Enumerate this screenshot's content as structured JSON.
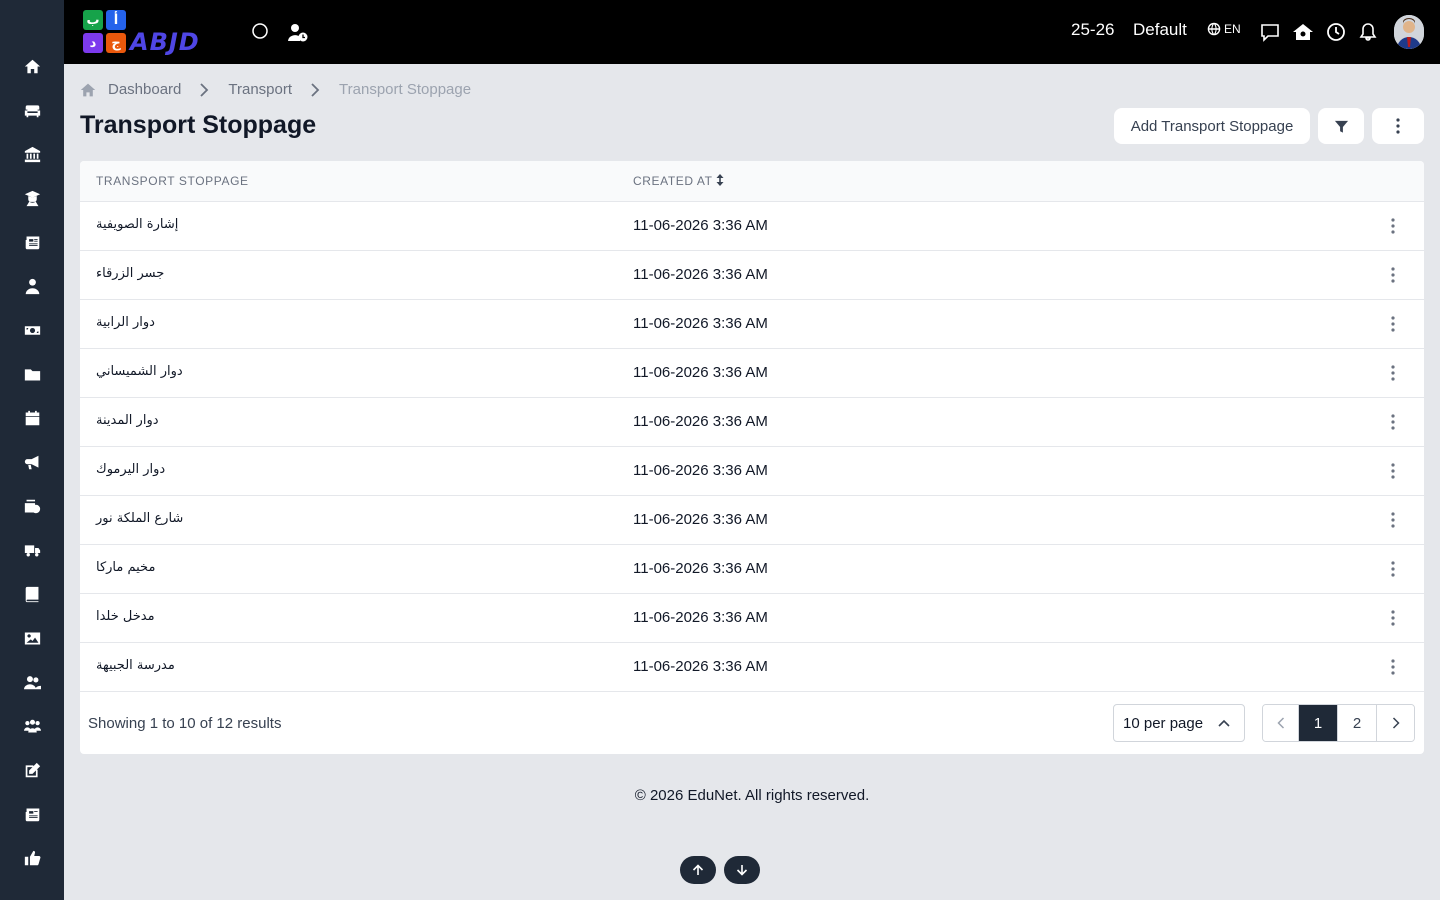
{
  "app": {
    "logo_letters": [
      "ب",
      "أ",
      "ج",
      "د"
    ],
    "logo_word": "ABJD",
    "brand_color": "#4f46e5"
  },
  "topbar": {
    "session": "25-26",
    "profile": "Default",
    "language": "EN",
    "icons": [
      "circle-icon",
      "user-clock-icon",
      "globe-icon",
      "chat-icon",
      "school-icon",
      "clock-icon",
      "bell-icon"
    ]
  },
  "sidebar": {
    "items": [
      "home-icon",
      "couch-icon",
      "bank-icon",
      "graduate-icon",
      "newspaper-icon",
      "user-tie-icon",
      "money-icon",
      "folder-icon",
      "calendar-icon",
      "megaphone-icon",
      "id-card-icon",
      "truck-icon",
      "book-icon",
      "image-icon",
      "users-icon",
      "people-group-icon",
      "edit-icon",
      "news-icon",
      "thumbs-up-icon"
    ]
  },
  "breadcrumb": {
    "items": [
      "Dashboard",
      "Transport",
      "Transport Stoppage"
    ]
  },
  "page": {
    "title": "Transport Stoppage"
  },
  "toolbar": {
    "add_label": "Add Transport Stoppage"
  },
  "table": {
    "headers": {
      "name": "TRANSPORT STOPPAGE",
      "created": "CREATED AT"
    },
    "rows": [
      {
        "name": "إشارة الصويفية",
        "created": "11-06-2026 3:36 AM"
      },
      {
        "name": "جسر الزرقاء",
        "created": "11-06-2026 3:36 AM"
      },
      {
        "name": "دوار الرابية",
        "created": "11-06-2026 3:36 AM"
      },
      {
        "name": "دوار الشميساني",
        "created": "11-06-2026 3:36 AM"
      },
      {
        "name": "دوار المدينة",
        "created": "11-06-2026 3:36 AM"
      },
      {
        "name": "دوار اليرموك",
        "created": "11-06-2026 3:36 AM"
      },
      {
        "name": "شارع الملكة نور",
        "created": "11-06-2026 3:36 AM"
      },
      {
        "name": "مخيم ماركا",
        "created": "11-06-2026 3:36 AM"
      },
      {
        "name": "مدخل خلدا",
        "created": "11-06-2026 3:36 AM"
      },
      {
        "name": "مدرسة الجبيهة",
        "created": "11-06-2026 3:36 AM"
      }
    ]
  },
  "pagination": {
    "showing": "Showing 1 to 10 of 12 results",
    "per_page": "10 per page",
    "pages": [
      "1",
      "2"
    ],
    "current": "1"
  },
  "footer": {
    "text": "© 2026 EduNet. All rights reserved."
  },
  "colors": {
    "sidebar_bg": "#1f2937",
    "topbar_bg": "#000000",
    "page_bg": "#e5e7eb",
    "active_page": "#1f2937"
  }
}
